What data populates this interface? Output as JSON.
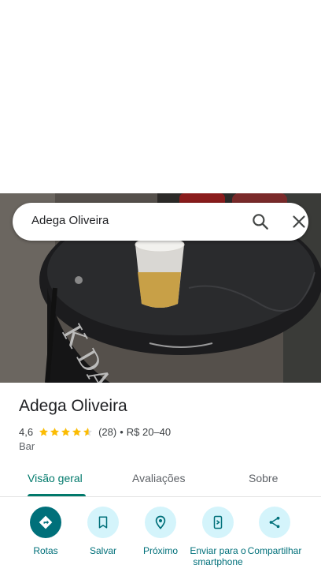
{
  "search": {
    "query": "Adega Oliveira"
  },
  "place": {
    "name": "Adega Oliveira",
    "rating": "4,6",
    "rating_value": 4.6,
    "reviews_count": "(28)",
    "separator": "•",
    "price": "R$ 20–40",
    "category": "Bar"
  },
  "tabs": [
    {
      "label": "Visão geral",
      "active": true
    },
    {
      "label": "Avaliações",
      "active": false
    },
    {
      "label": "Sobre",
      "active": false
    }
  ],
  "actions": [
    {
      "label": "Rotas",
      "icon": "directions-icon"
    },
    {
      "label": "Salvar",
      "icon": "bookmark-icon"
    },
    {
      "label": "Próximo",
      "icon": "nearby-icon"
    },
    {
      "label": "Enviar para o smartphone",
      "icon": "send-to-phone-icon"
    },
    {
      "label": "Compartilhar",
      "icon": "share-icon"
    }
  ],
  "colors": {
    "accent": "#00707a",
    "star": "#fbbc04",
    "chip_bg": "#d4f4fb"
  }
}
